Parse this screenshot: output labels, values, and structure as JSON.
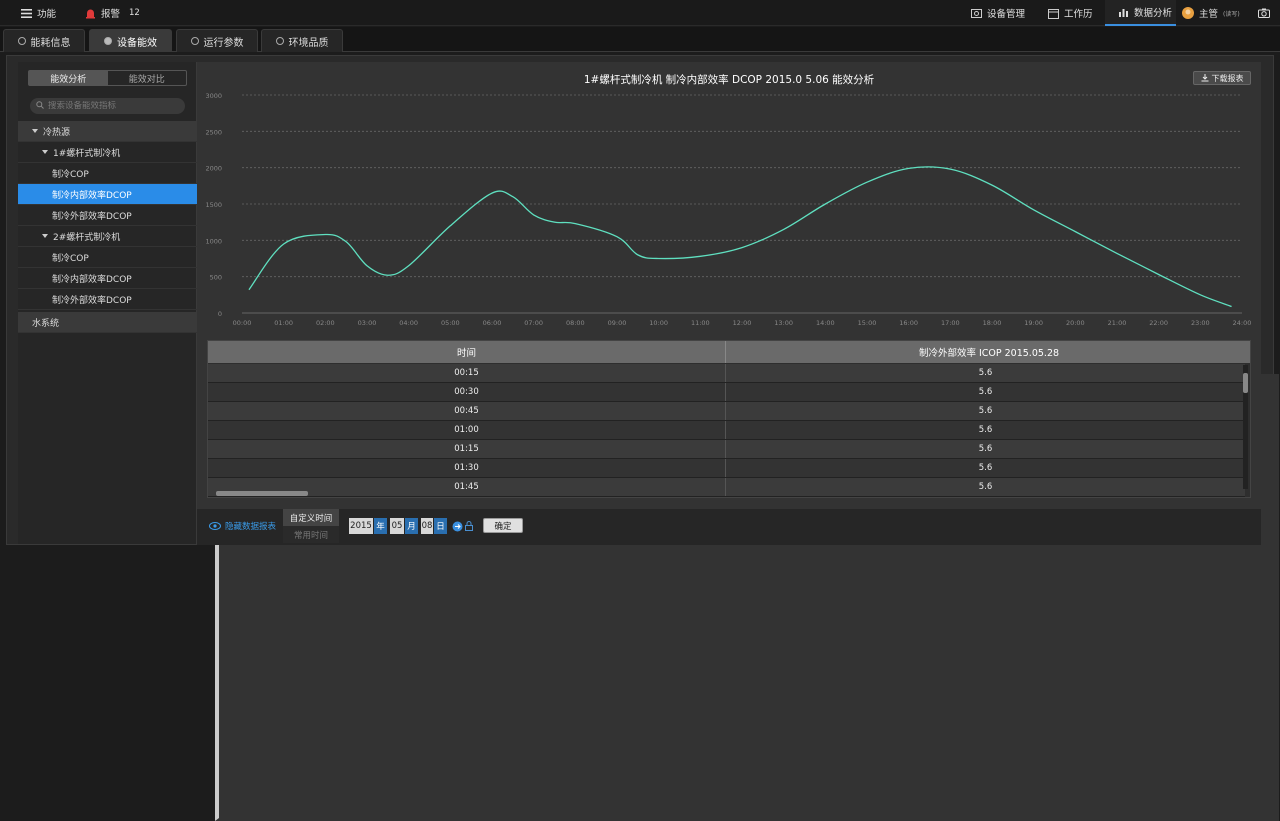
{
  "topbar": {
    "menu_label": "功能",
    "alarm_label": "报警",
    "alarm_count": "12",
    "nav": [
      "设备管理",
      "工作历",
      "数据分析"
    ],
    "user_name": "主管",
    "user_role": "(读写)"
  },
  "tabs": [
    "能耗信息",
    "设备能效",
    "运行参数",
    "环境品质"
  ],
  "sidebar": {
    "segments": [
      "能效分析",
      "能效对比"
    ],
    "search_placeholder": "搜索设备能效指标",
    "tree": [
      {
        "label": "冷热源",
        "level": 0,
        "expanded": true
      },
      {
        "label": "1#螺杆式制冷机",
        "level": 1,
        "expanded": true
      },
      {
        "label": "制冷COP",
        "level": 2
      },
      {
        "label": "制冷内部效率DCOP",
        "level": 2,
        "selected": true
      },
      {
        "label": "制冷外部效率DCOP",
        "level": 2
      },
      {
        "label": "2#螺杆式制冷机",
        "level": 1,
        "expanded": true
      },
      {
        "label": "制冷COP",
        "level": 2
      },
      {
        "label": "制冷内部效率DCOP",
        "level": 2
      },
      {
        "label": "制冷外部效率DCOP",
        "level": 2
      },
      {
        "label": "水系统",
        "level": 0,
        "expanded": false
      }
    ]
  },
  "chart": {
    "title": "1#螺杆式制冷机  制冷内部效率  DCOP  2015.0 5.06  能效分析",
    "download_label": "下载报表"
  },
  "chart_data": {
    "type": "line",
    "title": "1#螺杆式制冷机  制冷内部效率  DCOP  2015.0 5.06  能效分析",
    "x": [
      "00:00",
      "01:00",
      "02:00",
      "03:00",
      "04:00",
      "05:00",
      "06:00",
      "07:00",
      "08:00",
      "09:00",
      "10:00",
      "11:00",
      "12:00",
      "13:00",
      "14:00",
      "15:00",
      "16:00",
      "17:00",
      "18:00",
      "19:00",
      "20:00",
      "21:00",
      "22:00",
      "23:00",
      "24:00"
    ],
    "y_ticks": [
      0,
      500,
      1000,
      1500,
      2000,
      2500,
      3000
    ],
    "ylim": [
      0,
      3000
    ],
    "grid": true,
    "line_color": "#5fe0c0",
    "series": [
      {
        "points": [
          [
            "00:10",
            320
          ],
          [
            "01:00",
            950
          ],
          [
            "02:00",
            1080
          ],
          [
            "02:30",
            980
          ],
          [
            "03:00",
            650
          ],
          [
            "03:30",
            520
          ],
          [
            "04:00",
            650
          ],
          [
            "05:00",
            1200
          ],
          [
            "06:00",
            1650
          ],
          [
            "06:30",
            1600
          ],
          [
            "07:00",
            1350
          ],
          [
            "07:30",
            1250
          ],
          [
            "08:00",
            1230
          ],
          [
            "09:00",
            1050
          ],
          [
            "09:30",
            800
          ],
          [
            "10:00",
            750
          ],
          [
            "11:00",
            780
          ],
          [
            "12:00",
            900
          ],
          [
            "13:00",
            1150
          ],
          [
            "14:00",
            1500
          ],
          [
            "15:00",
            1800
          ],
          [
            "16:00",
            1990
          ],
          [
            "17:00",
            1980
          ],
          [
            "18:00",
            1760
          ],
          [
            "19:00",
            1420
          ],
          [
            "20:00",
            1120
          ],
          [
            "21:00",
            820
          ],
          [
            "22:00",
            530
          ],
          [
            "23:00",
            250
          ],
          [
            "23:45",
            90
          ]
        ]
      }
    ]
  },
  "table": {
    "headers": [
      "时间",
      "制冷外部效率 ICOP  2015.05.28"
    ],
    "rows": [
      [
        "00:15",
        "5.6"
      ],
      [
        "00:30",
        "5.6"
      ],
      [
        "00:45",
        "5.6"
      ],
      [
        "01:00",
        "5.6"
      ],
      [
        "01:15",
        "5.6"
      ],
      [
        "01:30",
        "5.6"
      ],
      [
        "01:45",
        "5.6"
      ]
    ]
  },
  "footer": {
    "hide_label": "隐藏数据报表",
    "custom_time": "自定义时间",
    "common_time": "常用时间",
    "year": "2015",
    "year_unit": "年",
    "month": "05",
    "month_unit": "月",
    "day": "08",
    "day_unit": "日",
    "confirm": "确定"
  }
}
